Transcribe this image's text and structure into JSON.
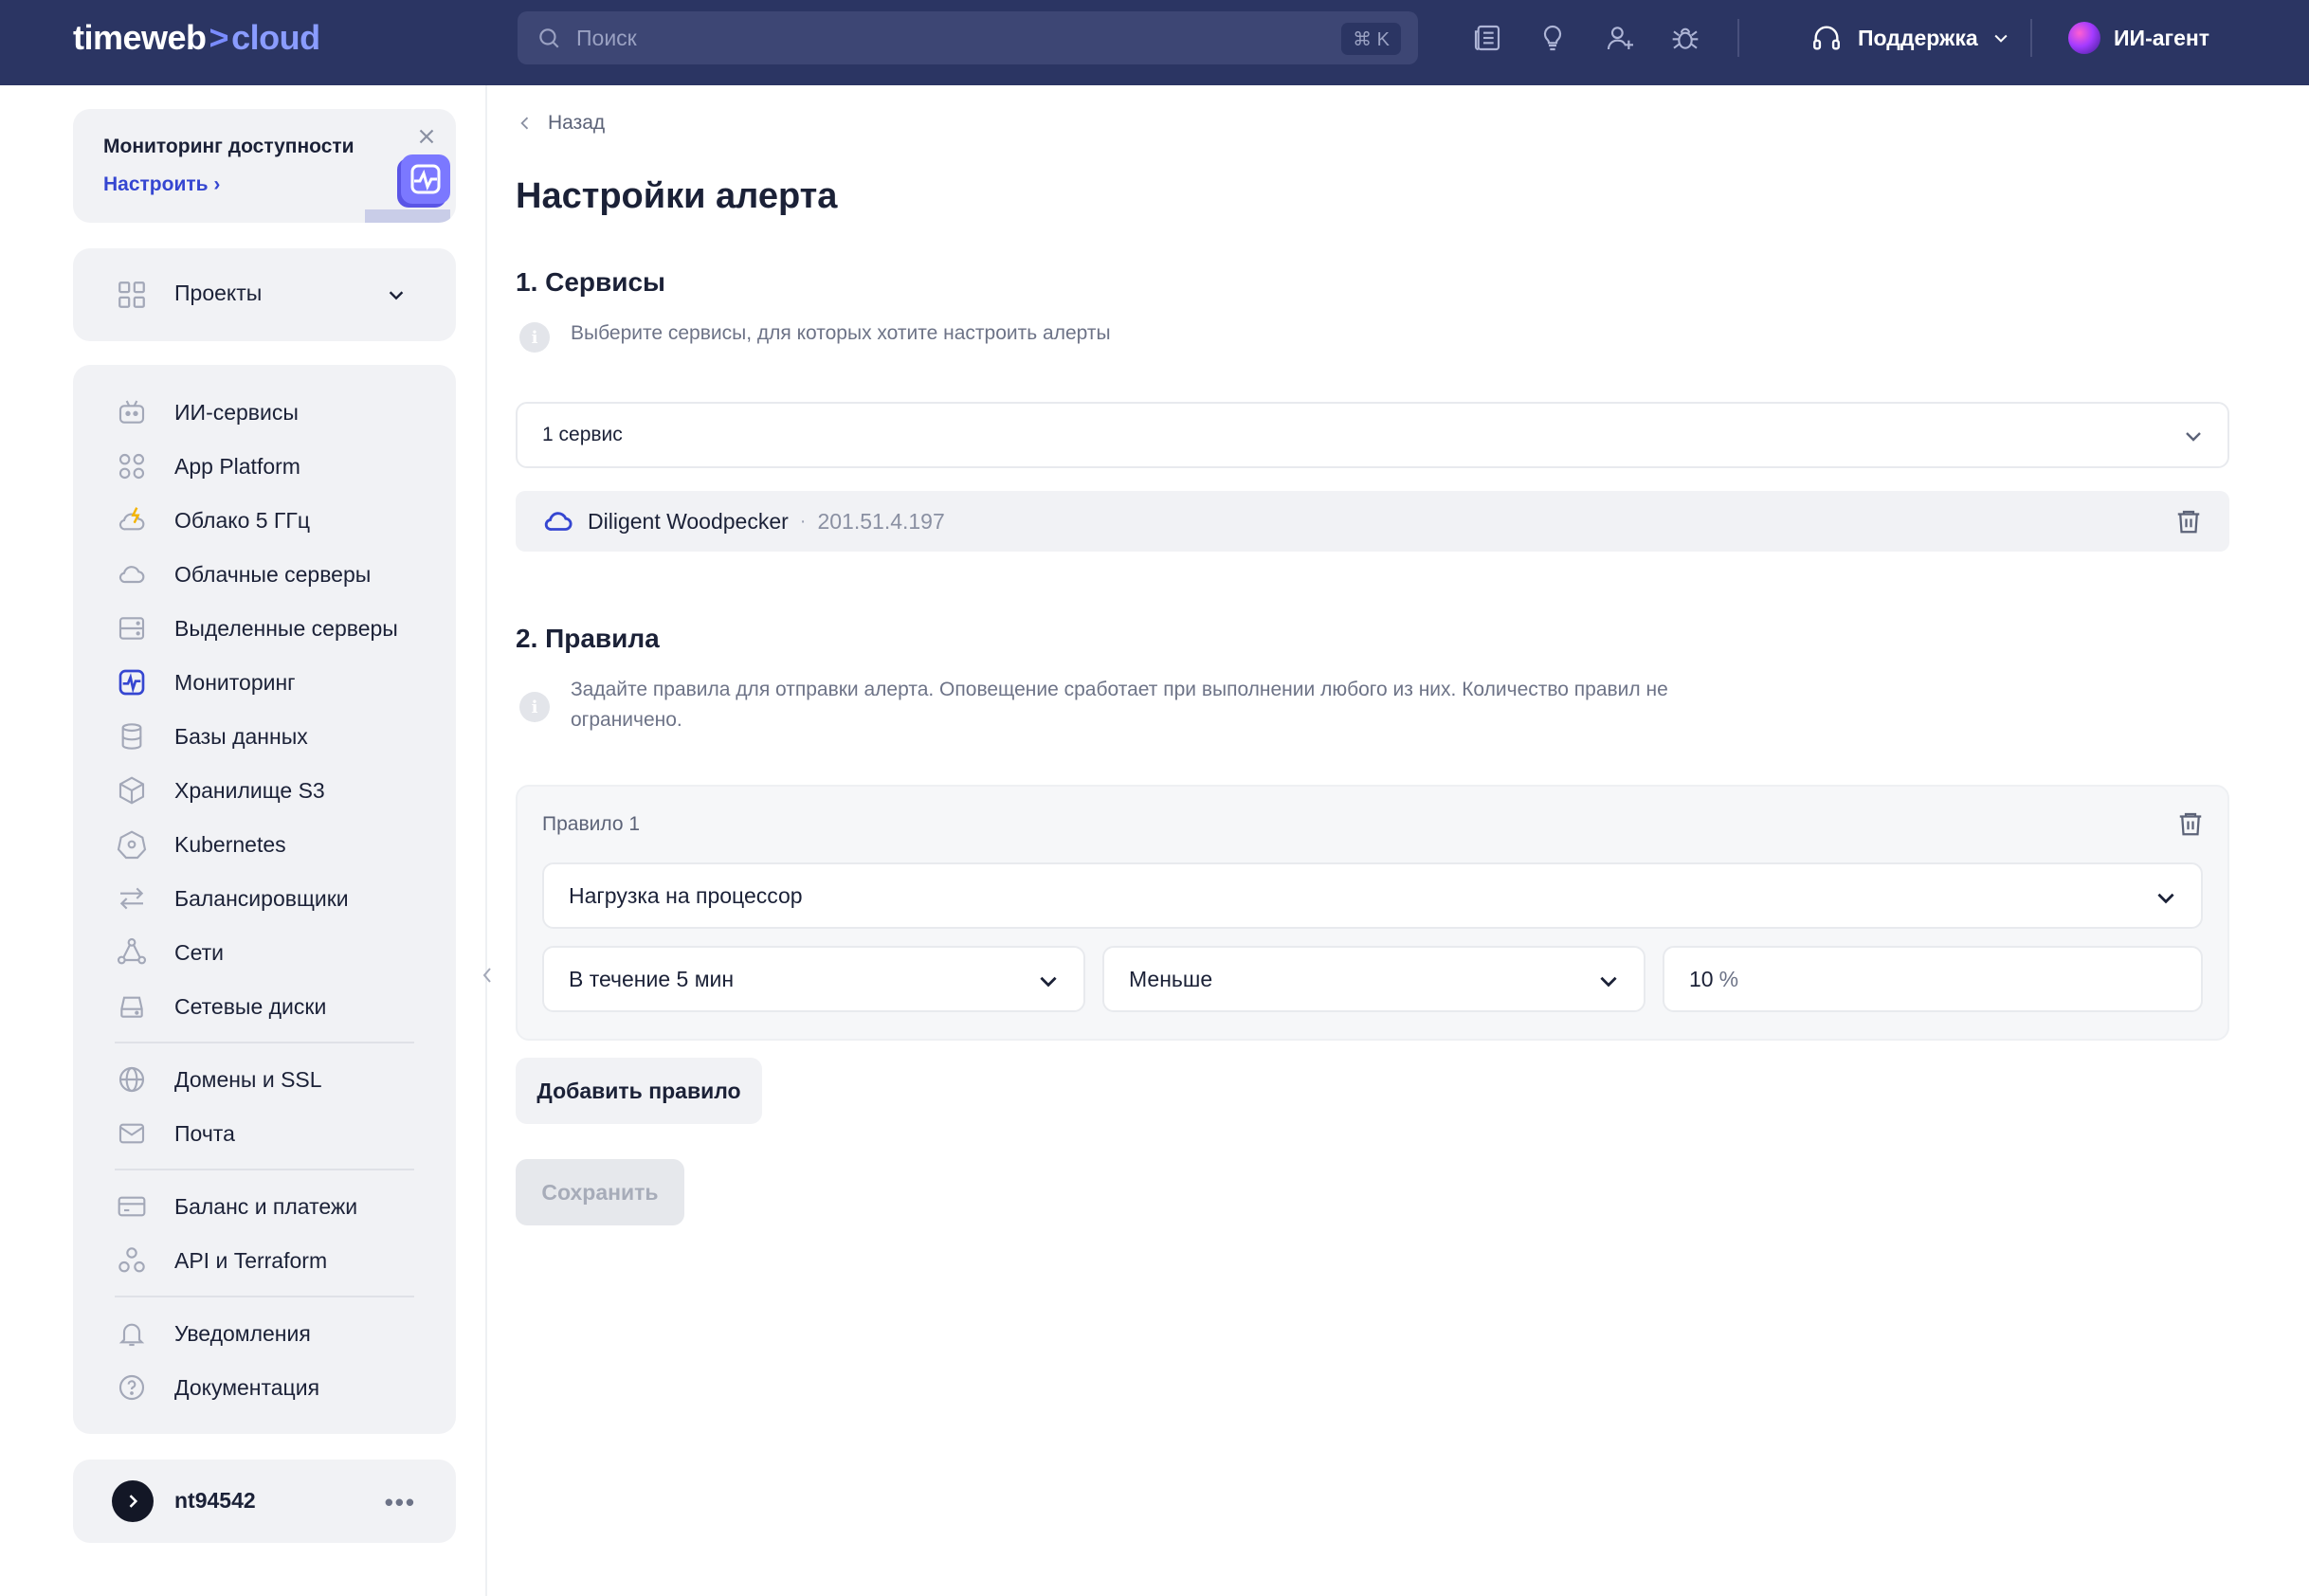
{
  "brand": {
    "part1": "timeweb",
    "part2": "cloud"
  },
  "search": {
    "placeholder": "Поиск",
    "shortcut": "⌘ K"
  },
  "topbar": {
    "support_label": "Поддержка",
    "agent_label": "ИИ-агент"
  },
  "promo": {
    "title": "Мониторинг доступности",
    "link": "Настроить"
  },
  "projects": {
    "label": "Проекты"
  },
  "nav": {
    "items": [
      {
        "label": "ИИ-сервисы",
        "icon": "robot-icon"
      },
      {
        "label": "App Platform",
        "icon": "apps-grid-icon"
      },
      {
        "label": "Облако 5 ГГц",
        "icon": "cloud-bolt-icon"
      },
      {
        "label": "Облачные серверы",
        "icon": "cloud-icon"
      },
      {
        "label": "Выделенные серверы",
        "icon": "server-icon"
      },
      {
        "label": "Мониторинг",
        "icon": "monitoring-icon",
        "active": true
      },
      {
        "label": "Базы данных",
        "icon": "database-icon"
      },
      {
        "label": "Хранилище S3",
        "icon": "cube-icon"
      },
      {
        "label": "Kubernetes",
        "icon": "kubernetes-icon"
      },
      {
        "label": "Балансировщики",
        "icon": "arrows-swap-icon"
      },
      {
        "label": "Сети",
        "icon": "network-icon"
      },
      {
        "label": "Сетевые диски",
        "icon": "disk-icon"
      },
      {
        "label": "Домены и SSL",
        "icon": "globe-icon"
      },
      {
        "label": "Почта",
        "icon": "mail-icon"
      },
      {
        "label": "Баланс и платежи",
        "icon": "card-icon"
      },
      {
        "label": "API и Terraform",
        "icon": "api-icon"
      },
      {
        "label": "Уведомления",
        "icon": "bell-icon"
      },
      {
        "label": "Документация",
        "icon": "help-icon"
      }
    ]
  },
  "user": {
    "name": "nt94542"
  },
  "main": {
    "back": "Назад",
    "title": "Настройки алерта",
    "services": {
      "heading": "1. Сервисы",
      "hint": "Выберите сервисы, для которых хотите настроить алерты",
      "select_value": "1 сервис",
      "item": {
        "name": "Diligent Woodpecker",
        "ip": "201.51.4.197"
      }
    },
    "rules": {
      "heading": "2. Правила",
      "hint_line1": "Задайте правила для отправки алерта. Оповещение сработает при выполнении любого из них. Количество правил не",
      "hint_line2": "ограничено.",
      "rule1": {
        "label": "Правило 1",
        "metric": "Нагрузка на процессор",
        "period": "В течение 5 мин",
        "condition": "Меньше",
        "value": "10",
        "unit": "%"
      }
    },
    "add_rule": "Добавить правило",
    "save": "Сохранить"
  },
  "colors": {
    "topbar": "#2b3563",
    "accent": "#3546d1",
    "active_icon": "#3546d1"
  }
}
